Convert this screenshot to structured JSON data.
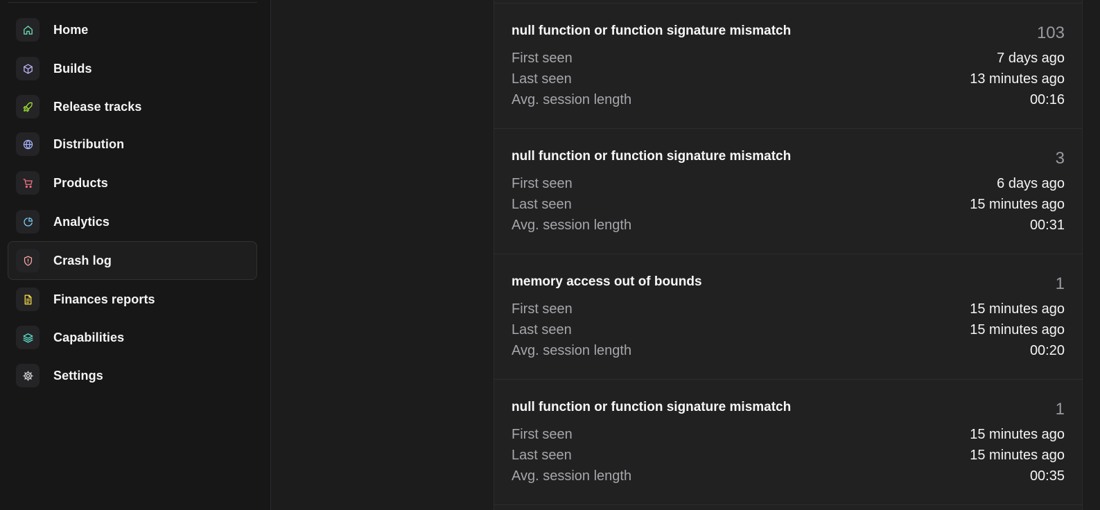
{
  "sidebar": {
    "items": [
      {
        "label": "Home",
        "icon": "home-icon",
        "color": "#6ee7b7"
      },
      {
        "label": "Builds",
        "icon": "box-icon",
        "color": "#c4b5fd"
      },
      {
        "label": "Release tracks",
        "icon": "rocket-icon",
        "color": "#a3e635"
      },
      {
        "label": "Distribution",
        "icon": "globe-icon",
        "color": "#a5b4fc"
      },
      {
        "label": "Products",
        "icon": "cart-icon",
        "color": "#fb7185"
      },
      {
        "label": "Analytics",
        "icon": "pie-chart-icon",
        "color": "#7dd3fc"
      },
      {
        "label": "Crash log",
        "icon": "shield-alert-icon",
        "color": "#fca5a5",
        "active": true
      },
      {
        "label": "Finances reports",
        "icon": "document-icon",
        "color": "#fde047"
      },
      {
        "label": "Capabilities",
        "icon": "layers-icon",
        "color": "#5eead4"
      },
      {
        "label": "Settings",
        "icon": "gear-icon",
        "color": "#e4e4e7"
      }
    ]
  },
  "crashes": [
    {
      "title": "null function or function signature mismatch",
      "count": "103",
      "first_seen_label": "First seen",
      "first_seen": "7 days ago",
      "last_seen_label": "Last seen",
      "last_seen": "13 minutes ago",
      "avg_label": "Avg. session length",
      "avg": "00:16"
    },
    {
      "title": "null function or function signature mismatch",
      "count": "3",
      "first_seen_label": "First seen",
      "first_seen": "6 days ago",
      "last_seen_label": "Last seen",
      "last_seen": "15 minutes ago",
      "avg_label": "Avg. session length",
      "avg": "00:31"
    },
    {
      "title": "memory access out of bounds",
      "count": "1",
      "first_seen_label": "First seen",
      "first_seen": "15 minutes ago",
      "last_seen_label": "Last seen",
      "last_seen": "15 minutes ago",
      "avg_label": "Avg. session length",
      "avg": "00:20"
    },
    {
      "title": "null function or function signature mismatch",
      "count": "1",
      "first_seen_label": "First seen",
      "first_seen": "15 minutes ago",
      "last_seen_label": "Last seen",
      "last_seen": "15 minutes ago",
      "avg_label": "Avg. session length",
      "avg": "00:35"
    }
  ]
}
